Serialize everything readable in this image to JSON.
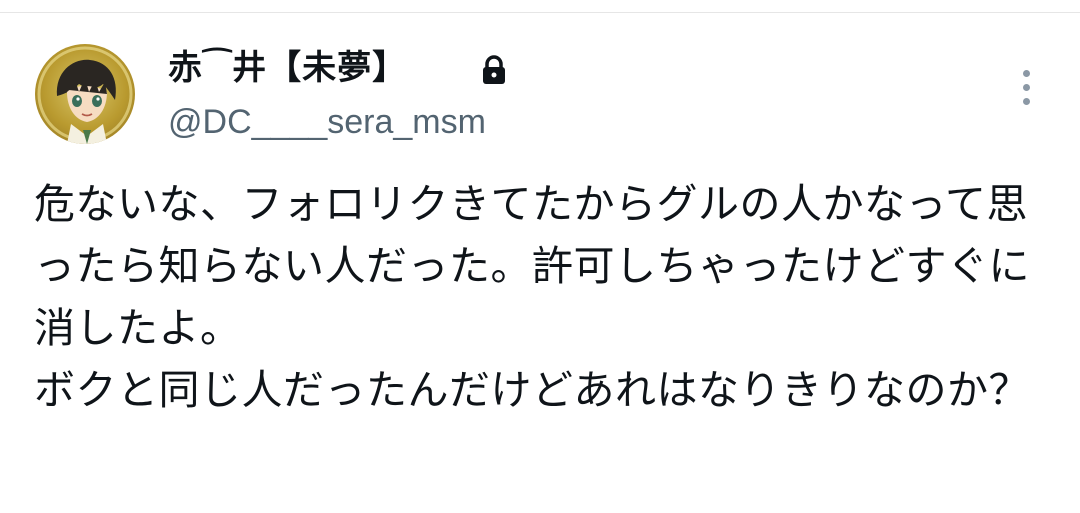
{
  "tweet": {
    "author": {
      "display_name": "赤⁀井【未夢】",
      "username": "@DC____sera_msm",
      "avatar_icon": "anime-character-avatar",
      "protected_icon": "lock-icon"
    },
    "more_icon": "more-vertical-icon",
    "text": "危ないな、フォロリクきてたからグルの人かなって思ったら知らない人だった。許可しちゃったけどすぐに消したよ。\nボクと同じ人だったんだけどあれはなりきりなのか？"
  },
  "colors": {
    "text": "#0f1419",
    "secondary_text": "#536471",
    "icon_gray": "#8b98a5",
    "avatar_gold": "#b99a2f"
  }
}
